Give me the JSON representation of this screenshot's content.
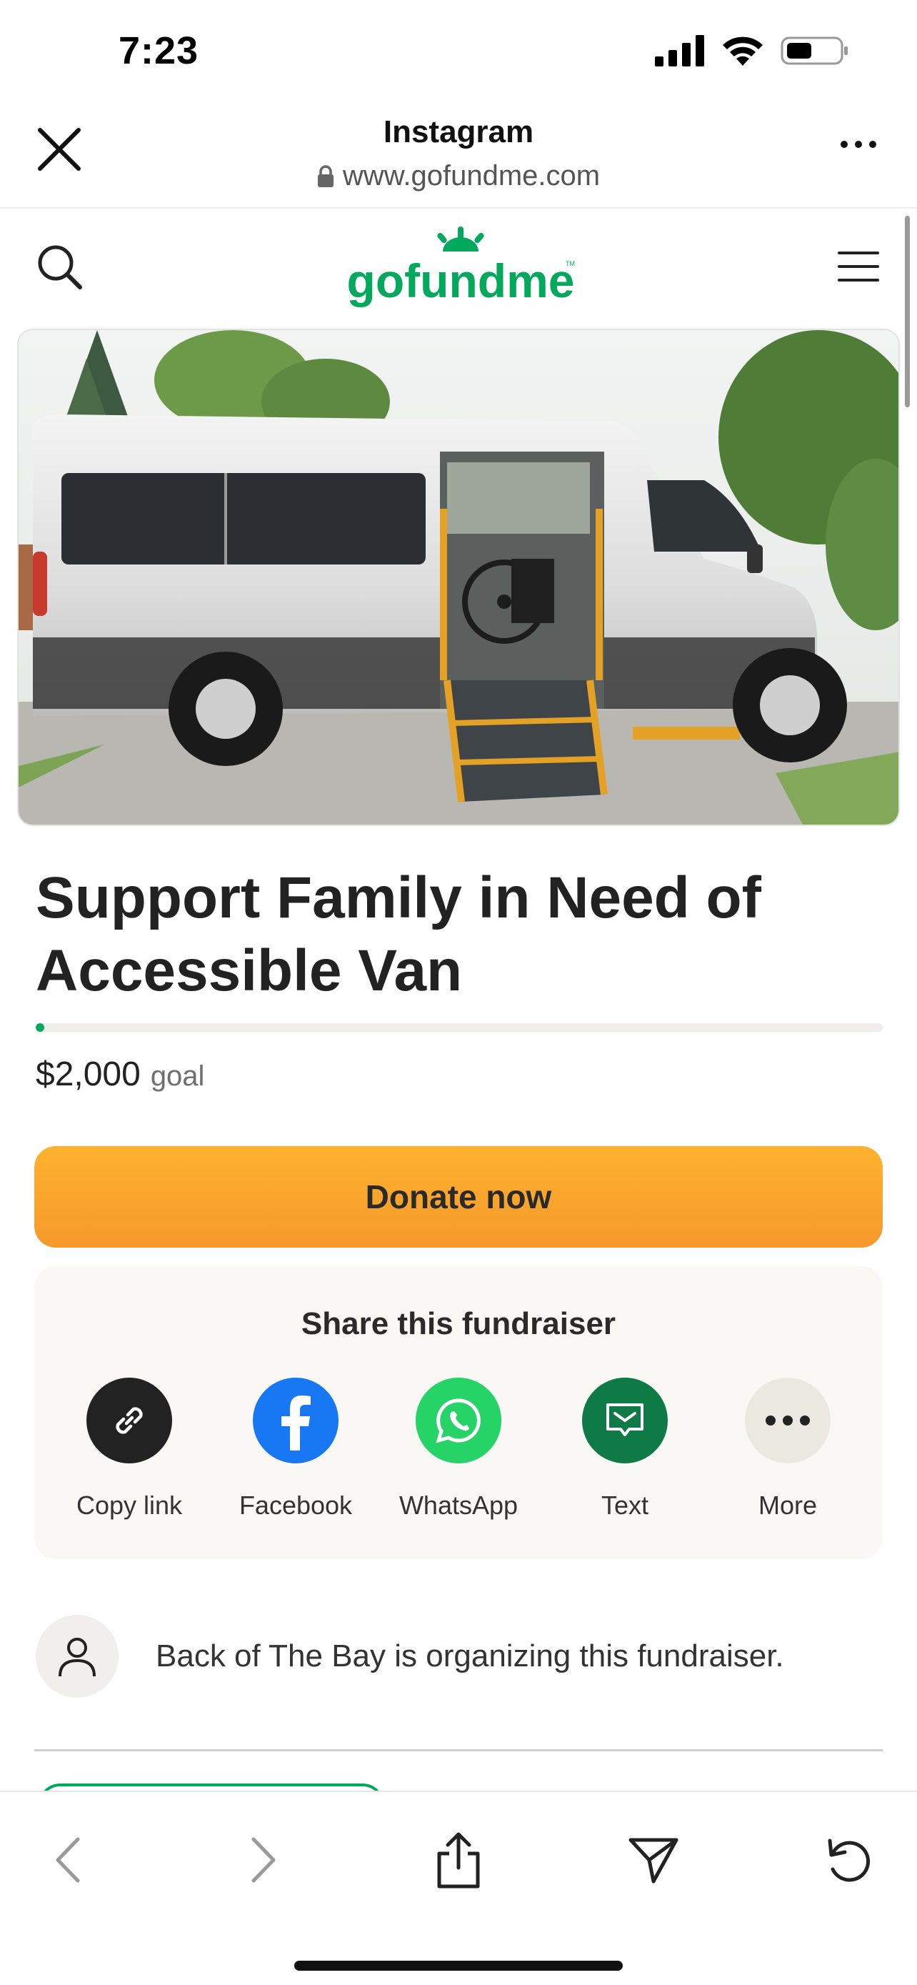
{
  "status_bar": {
    "time": "7:23"
  },
  "browser": {
    "title": "Instagram",
    "url": "www.gofundme.com"
  },
  "site": {
    "logo_text": "gofundme",
    "logo_tm": "TM"
  },
  "fundraiser": {
    "title": "Support Family in Need of Accessible Van",
    "goal_amount": "$2,000",
    "goal_label": "goal",
    "progress_fraction": 0.01,
    "donate_label": "Donate now"
  },
  "share": {
    "title": "Share this fundraiser",
    "items": [
      {
        "label": "Copy link",
        "icon": "link-icon",
        "color": "#222222"
      },
      {
        "label": "Facebook",
        "icon": "facebook-icon",
        "color": "#1877f2"
      },
      {
        "label": "WhatsApp",
        "icon": "whatsapp-icon",
        "color": "#25d366"
      },
      {
        "label": "Text",
        "icon": "message-icon",
        "color": "#0e7a45"
      },
      {
        "label": "More",
        "icon": "more-icon",
        "color": "#ebe8e1"
      }
    ]
  },
  "organizer": {
    "text": "Back of The Bay is organizing this fundraiser."
  },
  "colors": {
    "brand_green": "#02a95c",
    "donate_orange": "#fba830"
  }
}
